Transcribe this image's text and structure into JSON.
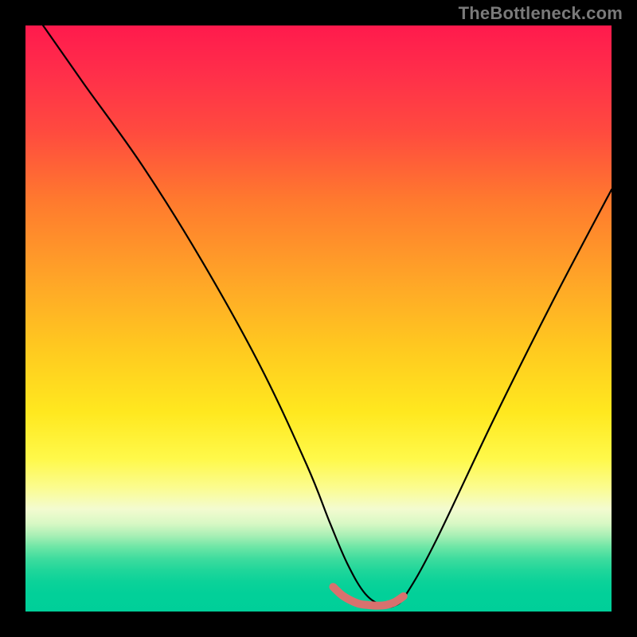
{
  "watermark": "TheBottleneck.com",
  "colors": {
    "background": "#000000",
    "curve_main": "#000000",
    "curve_highlight": "#d9716e",
    "gradient_top": "#ff1a4d",
    "gradient_mid": "#ffe81f",
    "gradient_bottom": "#00cf99"
  },
  "chart_data": {
    "type": "line",
    "title": "",
    "xlabel": "",
    "ylabel": "",
    "xlim": [
      0,
      100
    ],
    "ylim": [
      0,
      100
    ],
    "series": [
      {
        "name": "curve",
        "x": [
          3,
          10,
          20,
          30,
          40,
          48,
          52,
          55,
          58,
          61,
          63,
          65,
          70,
          80,
          90,
          100
        ],
        "y": [
          100,
          90,
          76,
          60,
          42,
          25,
          15,
          8,
          3,
          1,
          1,
          3,
          12,
          33,
          53,
          72
        ]
      },
      {
        "name": "highlight",
        "x": [
          52.5,
          54,
          55.5,
          57,
          58.5,
          60,
          61.5,
          63,
          64.5
        ],
        "y": [
          4.2,
          2.8,
          1.9,
          1.3,
          1.1,
          1.0,
          1.1,
          1.6,
          2.6
        ]
      }
    ],
    "annotations": []
  }
}
